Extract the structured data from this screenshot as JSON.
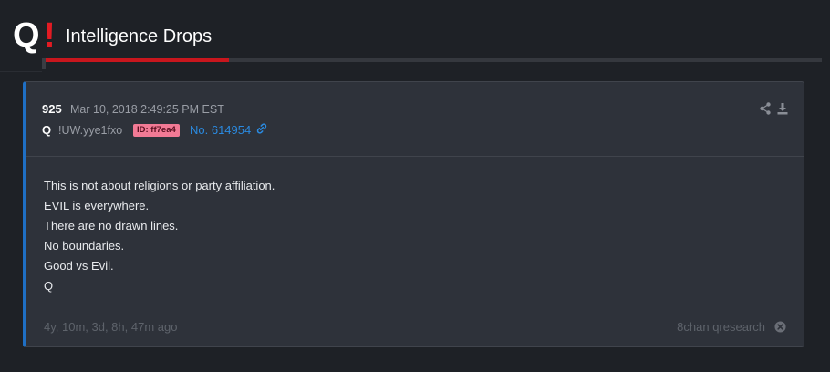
{
  "header": {
    "logo_q": "Q",
    "logo_bang": "!",
    "title": "Intelligence Drops",
    "progress_fraction": 0.24,
    "accent_color": "#c8161d"
  },
  "post": {
    "number": "925",
    "date": "Mar 10, 2018 2:49:25 PM EST",
    "author": "Q",
    "trip": "!UW.yye1fxo",
    "id_badge": "ID: ff7ea4",
    "post_no": "No. 614954",
    "lines": [
      "This is not about religions or party affiliation.",
      "EVIL is everywhere.",
      "There are no drawn lines.",
      "No boundaries.",
      "Good vs Evil.",
      "Q"
    ],
    "ago": "4y, 10m, 3d, 8h, 47m ago",
    "source": "8chan qresearch"
  },
  "icons": {
    "share": "share-icon",
    "download": "download-icon",
    "link": "link-icon",
    "close": "close-circle-icon"
  }
}
